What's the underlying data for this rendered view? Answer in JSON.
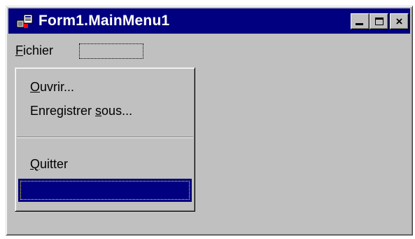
{
  "window": {
    "title": "Form1.MainMenu1",
    "buttons": {
      "minimize": "minimize",
      "maximize": "maximize",
      "close": "×"
    }
  },
  "menubar": {
    "items": [
      {
        "label_first": "F",
        "label_rest": "ichier"
      }
    ],
    "placeholder_label": ""
  },
  "dropdown": {
    "items": [
      {
        "label_first": "O",
        "label_rest": "uvrir..."
      },
      {
        "label_pre": "Enregistrer ",
        "label_u": "s",
        "label_post": "ous..."
      },
      {
        "type": "separator"
      },
      {
        "label_first": "Q",
        "label_rest": "uitter"
      },
      {
        "type": "new-item",
        "label": ""
      }
    ]
  },
  "colors": {
    "titlebar": "#000080",
    "face": "#c0c0c0",
    "selection": "#000080",
    "focus_dots": "#ffff00"
  },
  "icons": {
    "app": "app-icon"
  }
}
